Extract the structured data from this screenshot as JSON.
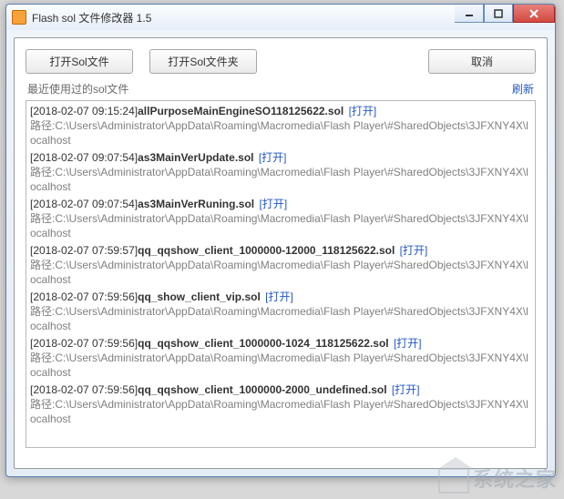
{
  "window": {
    "title": "Flash sol 文件修改器 1.5"
  },
  "buttons": {
    "open_file": "打开Sol文件",
    "open_folder": "打开Sol文件夹",
    "cancel": "取消"
  },
  "section": {
    "title": "最近使用过的sol文件",
    "refresh": "刷新"
  },
  "open_label": "[打开]",
  "path_prefix": "路径:",
  "common_path": "C:\\Users\\Administrator\\AppData\\Roaming\\Macromedia\\Flash Player\\#SharedObjects\\3JFXNY4X\\localhost",
  "entries": [
    {
      "ts": "[2018-02-07 09:15:24]",
      "name": "allPurposeMainEngineSO118125622.sol"
    },
    {
      "ts": "[2018-02-07 09:07:54]",
      "name": "as3MainVerUpdate.sol"
    },
    {
      "ts": "[2018-02-07 09:07:54]",
      "name": "as3MainVerRuning.sol"
    },
    {
      "ts": "[2018-02-07 07:59:57]",
      "name": "qq_qqshow_client_1000000-12000_118125622.sol"
    },
    {
      "ts": "[2018-02-07 07:59:56]",
      "name": "qq_show_client_vip.sol"
    },
    {
      "ts": "[2018-02-07 07:59:56]",
      "name": "qq_qqshow_client_1000000-1024_118125622.sol"
    },
    {
      "ts": "[2018-02-07 07:59:56]",
      "name": "qq_qqshow_client_1000000-2000_undefined.sol"
    }
  ],
  "watermark": "系统之家"
}
